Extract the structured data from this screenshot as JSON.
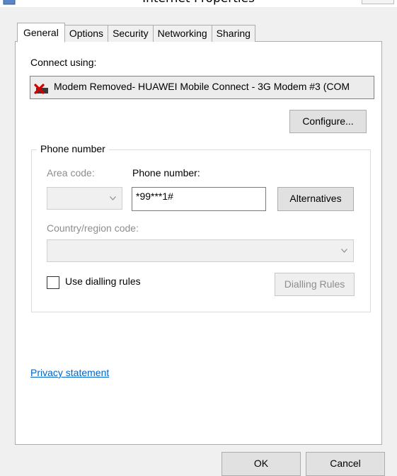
{
  "window": {
    "title": "Internet Properties"
  },
  "tabs": [
    {
      "label": "General",
      "active": true
    },
    {
      "label": "Options",
      "active": false
    },
    {
      "label": "Security",
      "active": false
    },
    {
      "label": "Networking",
      "active": false
    },
    {
      "label": "Sharing",
      "active": false
    }
  ],
  "connect": {
    "label": "Connect using:",
    "device": "Modem Removed- HUAWEI Mobile Connect - 3G Modem #3 (COM",
    "device_icon": "modem-disconnected-icon",
    "configure_label": "Configure..."
  },
  "phone_group": {
    "legend": "Phone number",
    "area_code_label": "Area code:",
    "area_code_value": "",
    "phone_number_label": "Phone number:",
    "phone_number_value": "*99***1#",
    "alternatives_label": "Alternatives",
    "country_label": "Country/region code:",
    "country_value": "",
    "use_dialling_rules_label": "Use dialling rules",
    "use_dialling_rules_checked": false,
    "dialling_rules_label": "Dialling Rules"
  },
  "privacy_link": "Privacy statement",
  "footer": {
    "ok_label": "OK",
    "cancel_label": "Cancel"
  },
  "colors": {
    "link": "#0066cc",
    "disabled_text": "#8d8d8d",
    "panel_bg": "#ffffff",
    "dialog_bg": "#f0f0f0"
  }
}
